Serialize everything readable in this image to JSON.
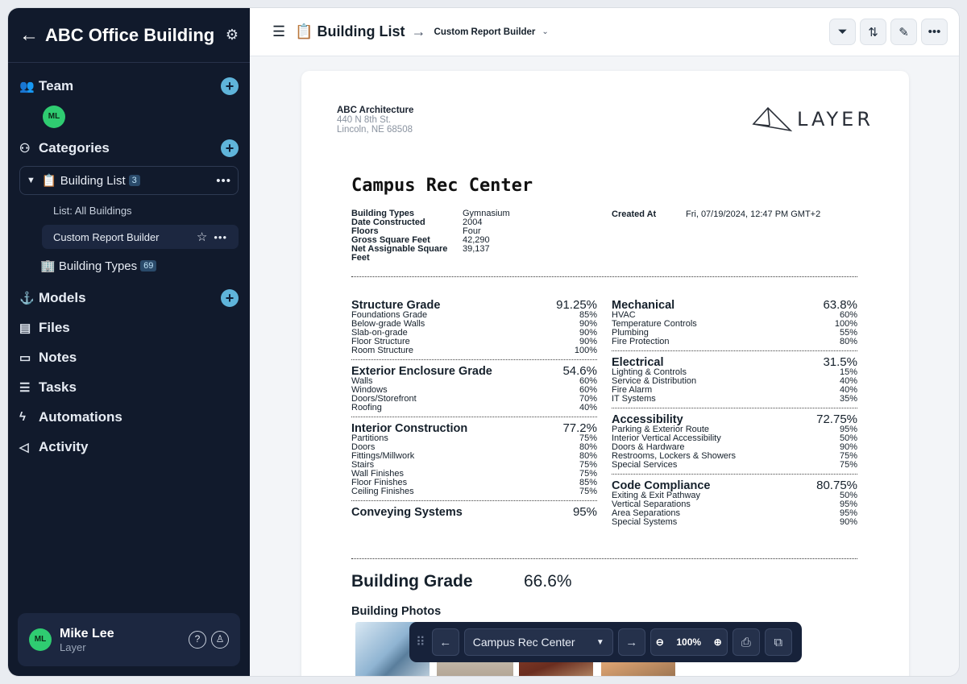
{
  "sidebar": {
    "title": "ABC Office Building",
    "team_label": "Team",
    "team_member": "ML",
    "categories_label": "Categories",
    "building_list": {
      "label": "📋 Building List",
      "count": "3"
    },
    "sub_items": [
      "List: All Buildings",
      "Custom Report Builder"
    ],
    "building_types": {
      "label": "🏢 Building Types",
      "count": "69"
    },
    "nav": [
      "Models",
      "Files",
      "Notes",
      "Tasks",
      "Automations",
      "Activity"
    ],
    "user": {
      "initials": "ML",
      "name": "Mike Lee",
      "org": "Layer"
    }
  },
  "header": {
    "crumb": "📋 Building List",
    "report": "Custom Report Builder"
  },
  "report": {
    "company": "ABC Architecture",
    "addr1": "440 N 8th St.",
    "addr2": "Lincoln, NE 68508",
    "logo": "LAYER",
    "title": "Campus Rec Center",
    "facts": [
      {
        "k": "Building Types",
        "v": "Gymnasium"
      },
      {
        "k": "Date Constructed",
        "v": "2004"
      },
      {
        "k": "Floors",
        "v": "Four"
      },
      {
        "k": "Gross Square Feet",
        "v": "42,290"
      },
      {
        "k": "Net Assignable Square Feet",
        "v": "39,137"
      }
    ],
    "created_k": "Created At",
    "created_v": "Fri, 07/19/2024, 12:47 PM GMT+2",
    "left": [
      {
        "name": "Structure Grade",
        "value": "91.25%",
        "items": [
          [
            "Foundations Grade",
            "85%"
          ],
          [
            "Below-grade Walls",
            "90%"
          ],
          [
            "Slab-on-grade",
            "90%"
          ],
          [
            "Floor Structure",
            "90%"
          ],
          [
            "Room Structure",
            "100%"
          ]
        ]
      },
      {
        "name": "Exterior Enclosure Grade",
        "value": "54.6%",
        "items": [
          [
            "Walls",
            "60%"
          ],
          [
            "Windows",
            "60%"
          ],
          [
            "Doors/Storefront",
            "70%"
          ],
          [
            "Roofing",
            "40%"
          ]
        ]
      },
      {
        "name": "Interior Construction",
        "value": "77.2%",
        "items": [
          [
            "Partitions",
            "75%"
          ],
          [
            "Doors",
            "80%"
          ],
          [
            "Fittings/Millwork",
            "80%"
          ],
          [
            "Stairs",
            "75%"
          ],
          [
            "Wall Finishes",
            "75%"
          ],
          [
            "Floor Finishes",
            "85%"
          ],
          [
            "Ceiling Finishes",
            "75%"
          ]
        ]
      },
      {
        "name": "Conveying Systems",
        "value": "95%",
        "items": []
      }
    ],
    "right": [
      {
        "name": "Mechanical",
        "value": "63.8%",
        "items": [
          [
            "HVAC",
            "60%"
          ],
          [
            "Temperature Controls",
            "100%"
          ],
          [
            "Plumbing",
            "55%"
          ],
          [
            "Fire Protection",
            "80%"
          ]
        ]
      },
      {
        "name": "Electrical",
        "value": "31.5%",
        "items": [
          [
            "Lighting & Controls",
            "15%"
          ],
          [
            "Service & Distribution",
            "40%"
          ],
          [
            "Fire Alarm",
            "40%"
          ],
          [
            "IT Systems",
            "35%"
          ]
        ]
      },
      {
        "name": "Accessibility",
        "value": "72.75%",
        "items": [
          [
            "Parking & Exterior Route",
            "95%"
          ],
          [
            "Interior Vertical Accessibility",
            "50%"
          ],
          [
            "Doors & Hardware",
            "90%"
          ],
          [
            "Restrooms, Lockers & Showers",
            "75%"
          ],
          [
            "Special Services",
            "75%"
          ]
        ]
      },
      {
        "name": "Code Compliance",
        "value": "80.75%",
        "items": [
          [
            "Exiting & Exit Pathway",
            "50%"
          ],
          [
            "Vertical Separations",
            "95%"
          ],
          [
            "Area Separations",
            "95%"
          ],
          [
            "Special Systems",
            "90%"
          ]
        ]
      }
    ],
    "building_grade_label": "Building Grade",
    "building_grade_value": "66.6%",
    "photos_label": "Building Photos"
  },
  "toolbar": {
    "selected": "Campus Rec Center",
    "zoom": "100%"
  }
}
